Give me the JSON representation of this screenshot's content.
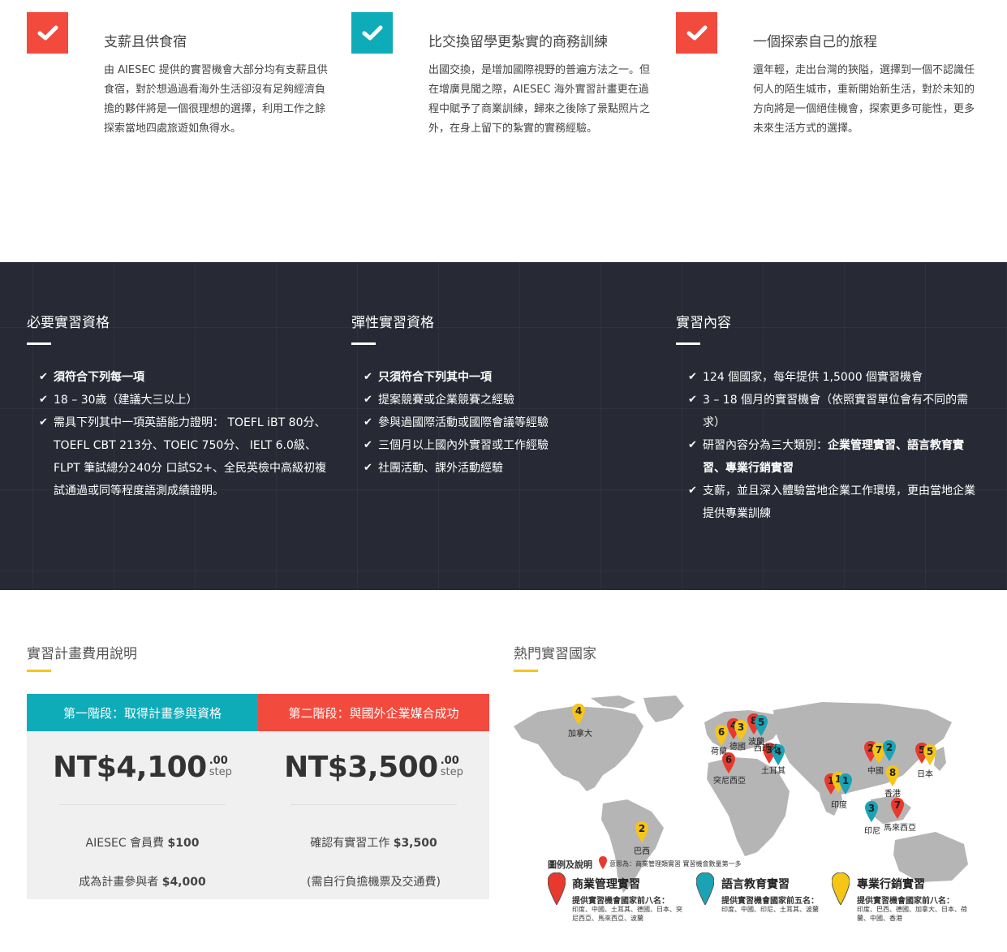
{
  "features": [
    {
      "color": "#f24a3d",
      "title": "支薪且供食宿",
      "text": "由 AIESEC 提供的實習機會大部分均有支薪且供食宿，對於想過過看海外生活卻沒有足夠經濟負擔的夥伴將是一個很理想的選擇，利用工作之餘探索當地四處旅遊如魚得水。"
    },
    {
      "color": "#0eacb8",
      "title": "比交換留學更紮實的商務訓練",
      "text": "出國交換，是增加國際視野的普遍方法之一。但在增廣見聞之際，AIESEC 海外實習計畫更在過程中賦予了商業訓練，歸來之後除了景點照片之外，在身上留下的紮實的實務經驗。"
    },
    {
      "color": "#f24a3d",
      "title": "一個探索自己的旅程",
      "text": "還年輕，走出台灣的狹隘，選擇到一個不認識任何人的陌生城市，重新開始新生活，對於未知的方向將是一個絕佳機會，探索更多可能性，更多未來生活方式的選擇。"
    }
  ],
  "requirements": {
    "title": "必要實習資格",
    "head": "須符合下列每一項",
    "items": [
      "18 – 30歲（建議大三以上）",
      "需具下列其中一項英語能力證明： TOEFL iBT 80分、TOEFL CBT 213分、TOEIC 750分、 IELT 6.0級、FLPT 筆試總分240分 口試S2+、全民英檢中高級初複試通過或同等程度語測成績證明。"
    ]
  },
  "flexible": {
    "title": "彈性實習資格",
    "head": "只須符合下列其中一項",
    "items": [
      "提案競賽或企業競賽之經驗",
      "參與過國際活動或國際會議等經驗",
      "三個月以上國內外實習或工作經驗",
      "社團活動、課外活動經驗"
    ]
  },
  "content": {
    "title": "實習內容",
    "items": [
      "124 個國家，每年提供 1,5000 個實習機會",
      "3 – 18 個月的實習機會（依照實習單位會有不同的需求）",
      "研習內容分為三大類別：",
      "支薪，並且深入體驗當地企業工作環境，更由當地企業提供專業訓練"
    ],
    "bold_part": "企業管理實習、語言教育實習、專業行銷實習"
  },
  "fees": {
    "title": "實習計畫費用說明",
    "stage1": {
      "label": "第一階段：取得計畫參與資格",
      "color": "#0eacb8",
      "amount": "NT$4,100",
      "cents": ".00",
      "unit": "step",
      "line1_text": "AIESEC 會員費 ",
      "line1_bold": "$100",
      "line2_text": "成為計畫參與者 ",
      "line2_bold": "$4,000"
    },
    "stage2": {
      "label": "第二階段：與國外企業媒合成功",
      "color": "#f24a3d",
      "amount": "NT$3,500",
      "cents": ".00",
      "unit": "step",
      "line1_text": "確認有實習工作 ",
      "line1_bold": "$3,500",
      "line2_text": "(需自行負擔機票及交通費)",
      "line2_bold": ""
    }
  },
  "countries": {
    "title": "熱門實習國家",
    "labels": [
      "加拿大",
      "荷蘭",
      "德國",
      "波蘭",
      "西班牙",
      "突尼西亞",
      "土耳其",
      "中國",
      "香港",
      "日本",
      "印度",
      "印尼",
      "馬來西亞",
      "巴西"
    ],
    "legend": {
      "title": "圖例及說明",
      "note": "意思為：商業管理類實習 實習機會數量第一多",
      "cats": [
        {
          "name": "商業管理實習",
          "color": "#e8392e",
          "sub": "提供實習機會國家前八名：",
          "list": "印度、中國、土耳其、德國、日本、突尼西亞、馬來西亞、波蘭"
        },
        {
          "name": "語言教育實習",
          "color": "#1aa3b5",
          "sub": "提供實習機會國家前五名：",
          "list": "印度、中國、印尼、土耳其、波蘭"
        },
        {
          "name": "專業行銷實習",
          "color": "#f5c518",
          "sub": "提供實習機會國家前八名：",
          "list": "印度、巴西、德國、加拿大、日本、荷蘭、中國、香港"
        }
      ]
    }
  }
}
